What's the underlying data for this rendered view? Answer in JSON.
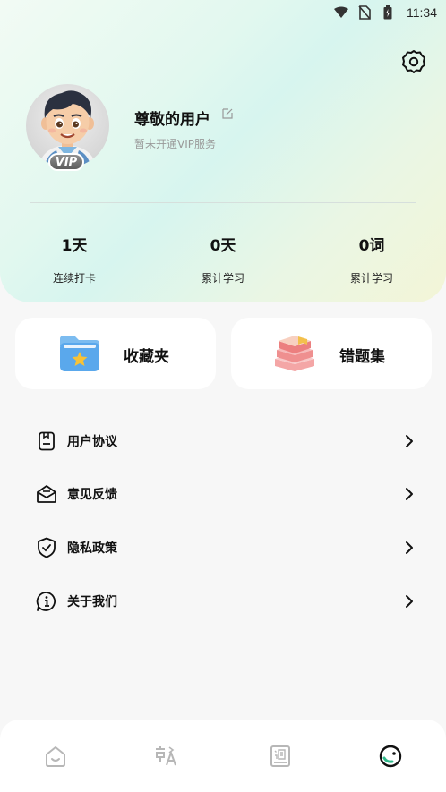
{
  "status_bar": {
    "time": "11:34",
    "icons": [
      "wifi-icon",
      "no-sim-icon",
      "battery-icon"
    ]
  },
  "header": {
    "settings_icon": "gear-icon",
    "user_name": "尊敬的用户",
    "vip_status": "暂未开通VIP服务",
    "vip_badge": "VIP",
    "stats": [
      {
        "value": "1天",
        "label": "连续打卡"
      },
      {
        "value": "0天",
        "label": "累计学习"
      },
      {
        "value": "0词",
        "label": "累计学习"
      }
    ]
  },
  "cards": {
    "favorites": "收藏夹",
    "mistakes": "错题集"
  },
  "menu": [
    {
      "label": "用户协议",
      "icon": "document-icon"
    },
    {
      "label": "意见反馈",
      "icon": "feedback-icon"
    },
    {
      "label": "隐私政策",
      "icon": "shield-icon"
    },
    {
      "label": "关于我们",
      "icon": "info-icon"
    }
  ],
  "bottom_nav": [
    {
      "icon": "home-icon",
      "active": false
    },
    {
      "icon": "translate-icon",
      "active": false
    },
    {
      "icon": "dictionary-icon",
      "active": false
    },
    {
      "icon": "profile-icon",
      "active": true
    }
  ],
  "colors": {
    "accent": "#2fb98a",
    "text": "#111111",
    "muted": "#999999",
    "background": "#f7f7f7"
  }
}
